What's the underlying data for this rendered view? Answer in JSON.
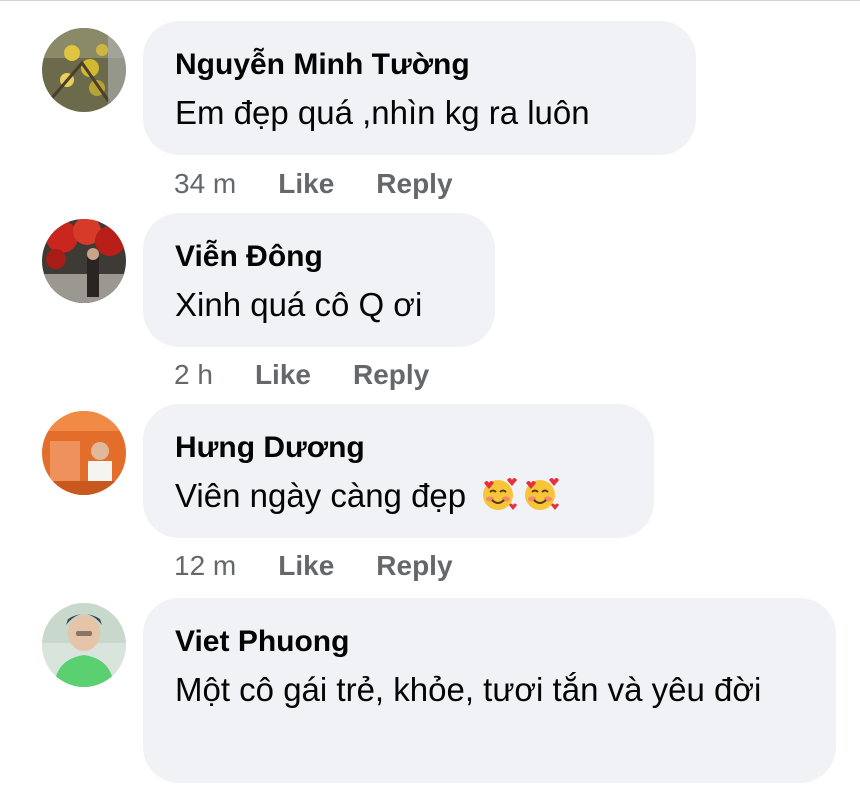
{
  "comments": [
    {
      "author": "Nguyễn Minh Tường",
      "text": "Em đẹp quá ,nhìn kg ra luôn",
      "time": "34 m",
      "like_label": "Like",
      "reply_label": "Reply"
    },
    {
      "author": "Viễn Đông",
      "text": "Xinh quá cô Q ơi",
      "time": "2 h",
      "like_label": "Like",
      "reply_label": "Reply"
    },
    {
      "author": "Hưng Dương",
      "text": "Viên ngày càng đẹp",
      "emojis": [
        "smiling-face-with-hearts-icon",
        "smiling-face-with-hearts-icon"
      ],
      "time": "12 m",
      "like_label": "Like",
      "reply_label": "Reply"
    },
    {
      "author": "Viet Phuong",
      "text": "Một cô gái trẻ, khỏe, tươi tắn và yêu đời"
    }
  ],
  "colors": {
    "bubble_bg": "#f0f2f5",
    "meta_text": "#65676b",
    "name_text": "#050505"
  }
}
